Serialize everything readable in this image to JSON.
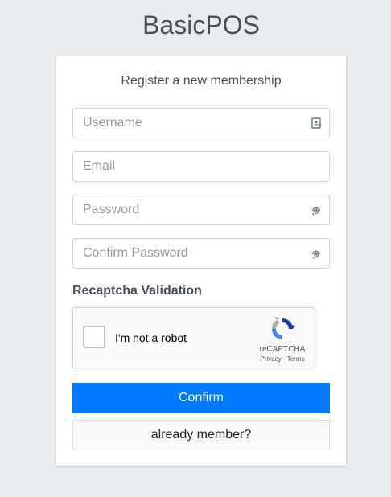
{
  "brand": {
    "bold": "Basic",
    "light": "POS"
  },
  "card": {
    "title": "Register a new membership"
  },
  "form": {
    "username": {
      "placeholder": "Username",
      "value": ""
    },
    "email": {
      "placeholder": "Email",
      "value": ""
    },
    "password": {
      "placeholder": "Password",
      "value": ""
    },
    "confirm_password": {
      "placeholder": "Confirm Password",
      "value": ""
    }
  },
  "captcha": {
    "section_label": "Recaptcha Validation",
    "checkbox_label": "I'm not a robot",
    "brand": "reCAPTCHA",
    "links": "Privacy - Terms"
  },
  "buttons": {
    "confirm": "Confirm",
    "already_member": "already member?"
  },
  "colors": {
    "background": "#e9ecef",
    "primary": "#007bff",
    "text": "#495057"
  },
  "icons": {
    "username": "id-card-icon",
    "password": "fingerprint-icon",
    "confirm_password": "fingerprint-icon",
    "recaptcha": "recaptcha-logo-icon"
  }
}
